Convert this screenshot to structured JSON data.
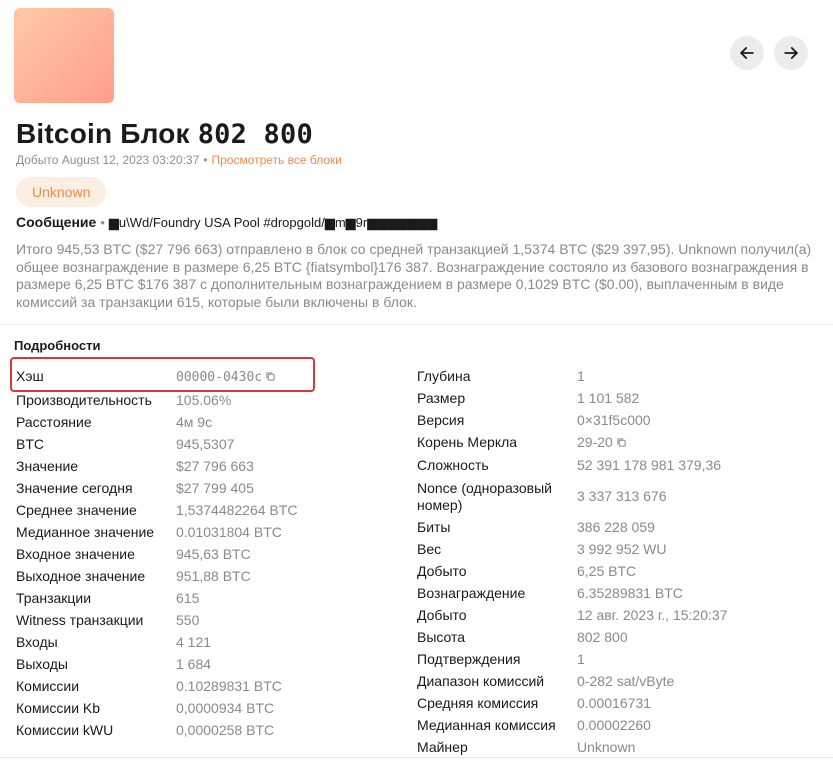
{
  "nav": {
    "prev_icon": "arrow-left-icon",
    "next_icon": "arrow-right-icon"
  },
  "header": {
    "title_prefix": "Bitcoin Блок",
    "block_number": "802 800",
    "mined_text": "Добыто August 12, 2023 03:20:37",
    "dot": "•",
    "view_all_link": "Просмотреть все блоки",
    "pool_badge": "Unknown",
    "accent_color": "#f0894b"
  },
  "message": {
    "label": "Сообщение",
    "dot": "•",
    "value": "▆u\\Wd/Foundry USA Pool #dropgold/▆m▆9r▆▆▆▆▆▆▆"
  },
  "summary": "Итого 945,53 BTC ($27 796 663) отправлено в блок со средней транзакцией 1,5374 BTC ($29 397,95). Unknown получил(а) общее вознаграждение в размере 6,25 BTC {fiatsymbol}176 387. Вознаграждение состояло из базового вознаграждения в размере 6,25 BTC $176 387 с дополнительным вознаграждением в размере 0,1029 BTC ($0.00), выплаченным в виде комиссий за транзакции 615, которые были включены в блок.",
  "details": {
    "title": "Подробности",
    "left": [
      {
        "key": "Хэш",
        "value": "00000-0430c",
        "mono": true,
        "copy": true
      },
      {
        "key": "Производительность",
        "value": "105.06%"
      },
      {
        "key": "Расстояние",
        "value": "4м 9с"
      },
      {
        "key": "BTC",
        "value": "945,5307"
      },
      {
        "key": "Значение",
        "value": "$27 796 663"
      },
      {
        "key": "Значение сегодня",
        "value": "$27 799 405"
      },
      {
        "key": "Среднее значение",
        "value": "1,5374482264 BTC"
      },
      {
        "key": "Медианное значение",
        "value": "0.01031804 BTC"
      },
      {
        "key": "Входное значение",
        "value": "945,63 BTC"
      },
      {
        "key": "Выходное значение",
        "value": "951,88 BTC"
      },
      {
        "key": "Транзакции",
        "value": "615"
      },
      {
        "key": "Witness транзакции",
        "value": "550"
      },
      {
        "key": "Входы",
        "value": "4 121"
      },
      {
        "key": "Выходы",
        "value": "1 684"
      },
      {
        "key": "Комиссии",
        "value": "0.10289831 BTC"
      },
      {
        "key": "Комиссии Kb",
        "value": "0,0000934 BTC"
      },
      {
        "key": "Комиссии kWU",
        "value": "0,0000258 BTC"
      }
    ],
    "right": [
      {
        "key": "Глубина",
        "value": "1"
      },
      {
        "key": "Размер",
        "value": "1 101 582"
      },
      {
        "key": "Версия",
        "value": "0×31f5c000"
      },
      {
        "key": "Корень Меркла",
        "value": "29-20",
        "copy": true
      },
      {
        "key": "Сложность",
        "value": "52 391 178 981 379,36"
      },
      {
        "key": "Nonce (одноразовый номер)",
        "value": "3 337 313 676",
        "tall": true
      },
      {
        "key": "Биты",
        "value": "386 228 059"
      },
      {
        "key": "Вес",
        "value": "3 992 952 WU"
      },
      {
        "key": "Добыто",
        "value": "6,25 BTC"
      },
      {
        "key": "Вознаграждение",
        "value": "6.35289831 BTC"
      },
      {
        "key": "Добыто",
        "value": "12 авг. 2023 г., 15:20:37"
      },
      {
        "key": "Высота",
        "value": "802 800"
      },
      {
        "key": "Подтверждения",
        "value": "1"
      },
      {
        "key": "Диапазон комиссий",
        "value": "0-282 sat/vByte"
      },
      {
        "key": "Средняя комиссия",
        "value": "0.00016731"
      },
      {
        "key": "Медианная комиссия",
        "value": "0.00002260"
      },
      {
        "key": "Майнер",
        "value": "Unknown"
      }
    ]
  }
}
